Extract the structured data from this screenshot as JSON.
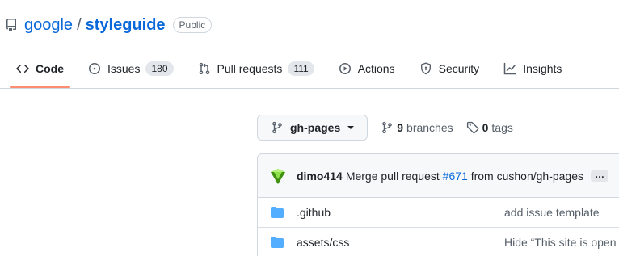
{
  "repo": {
    "owner": "google",
    "separator": "/",
    "name": "styleguide",
    "visibility": "Public"
  },
  "tabs": [
    {
      "label": "Code",
      "icon": "code-icon",
      "active": true
    },
    {
      "label": "Issues",
      "icon": "issue-opened-icon",
      "count": "180"
    },
    {
      "label": "Pull requests",
      "icon": "git-pull-request-icon",
      "count": "111"
    },
    {
      "label": "Actions",
      "icon": "play-icon"
    },
    {
      "label": "Security",
      "icon": "shield-icon"
    },
    {
      "label": "Insights",
      "icon": "graph-icon"
    }
  ],
  "branch": {
    "current": "gh-pages",
    "branches_count": "9",
    "branches_label": "branches",
    "tags_count": "0",
    "tags_label": "tags"
  },
  "commit": {
    "author": "dimo414",
    "message_prefix": "Merge pull request",
    "pr_link": "#671",
    "message_suffix": "from cushon/gh-pages",
    "more": "…"
  },
  "files": [
    {
      "name": ".github",
      "type": "folder",
      "last_commit": "add issue template"
    },
    {
      "name": "assets/css",
      "type": "folder",
      "last_commit": "Hide “This site is open s"
    }
  ],
  "colors": {
    "link": "#0969da",
    "active_tab_underline": "#fd8c73",
    "folder": "#54aeff",
    "avatar_green": "#5fbb1c"
  }
}
